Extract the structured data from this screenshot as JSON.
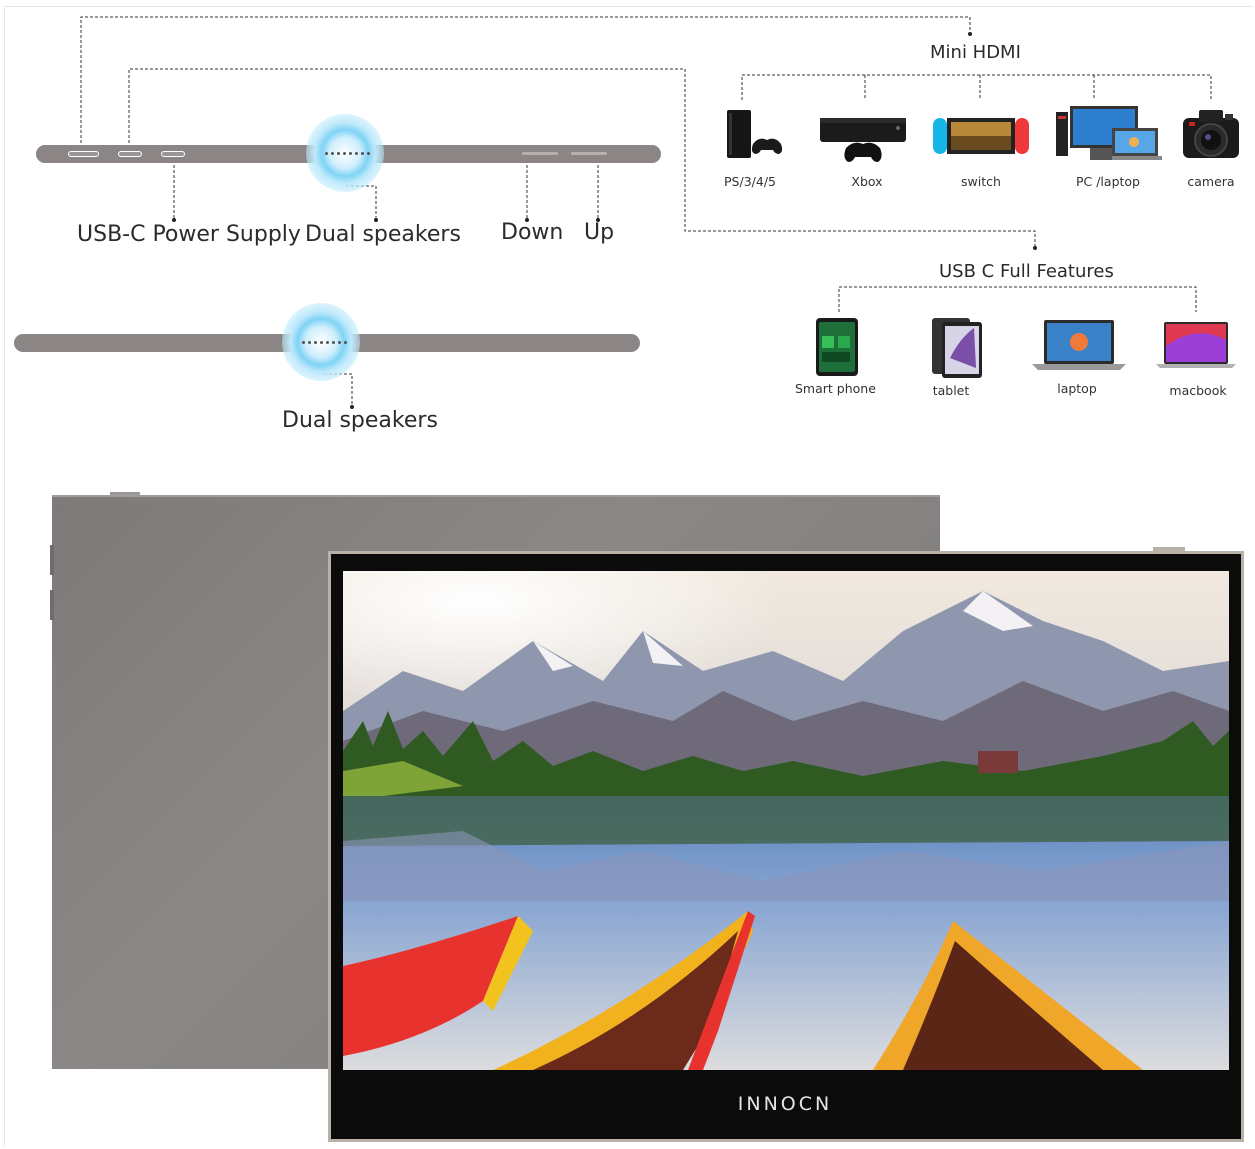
{
  "labels": {
    "usb_c_power": "USB-C Power Supply",
    "dual_speakers_top": "Dual speakers",
    "down": "Down",
    "up": "Up",
    "dual_speakers_bottom": "Dual speakers"
  },
  "mini_hdmi": {
    "title": "Mini HDMI",
    "devices": [
      {
        "label": "PS/3/4/5",
        "icon": "playstation-icon"
      },
      {
        "label": "Xbox",
        "icon": "xbox-icon"
      },
      {
        "label": "switch",
        "icon": "nintendo-switch-icon"
      },
      {
        "label": "PC /laptop",
        "icon": "pc-laptop-icon"
      },
      {
        "label": "camera",
        "icon": "camera-icon"
      }
    ]
  },
  "usb_c": {
    "title": "USB C Full Features",
    "devices": [
      {
        "label": "Smart phone",
        "icon": "smartphone-icon"
      },
      {
        "label": "tablet",
        "icon": "tablet-icon"
      },
      {
        "label": "laptop",
        "icon": "laptop-icon"
      },
      {
        "label": "macbook",
        "icon": "macbook-icon"
      }
    ]
  },
  "monitor": {
    "brand": "INNOCN",
    "screen_image": "lake-mountains-boats-landscape"
  },
  "colors": {
    "bar": "#8b8685",
    "glow": "#7fd3f5",
    "frame": "#0b0b0b"
  }
}
